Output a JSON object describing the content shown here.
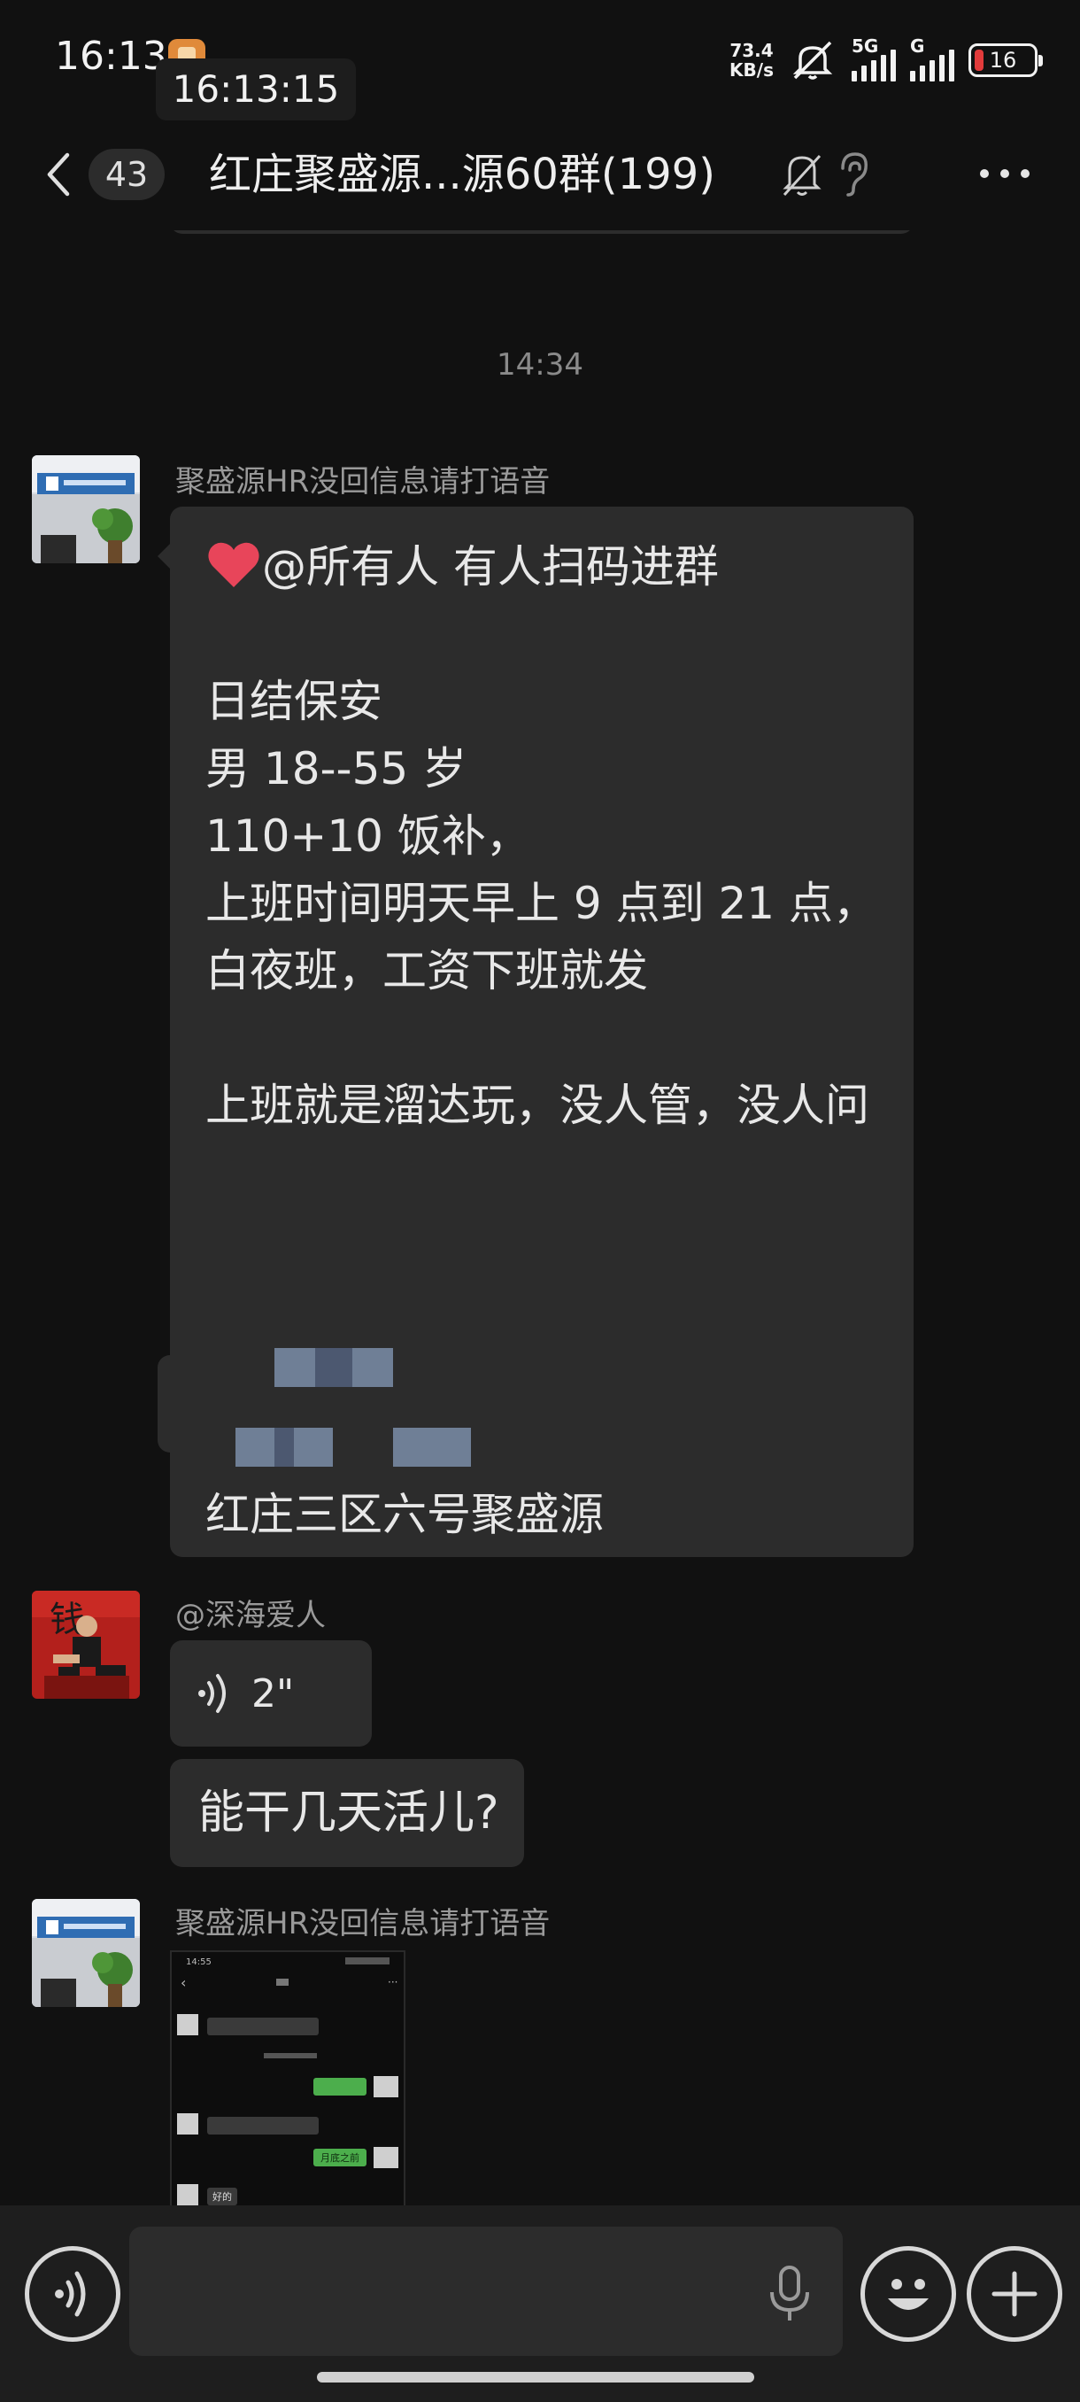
{
  "status_bar": {
    "time": "16:13",
    "clock_overlay": "16:13:15",
    "net_speed_value": "73.4",
    "net_speed_unit": "KB/s",
    "signal1_label": "5G",
    "signal2_label": "G",
    "battery_level": "16",
    "battery_color": "#e23b3b"
  },
  "header": {
    "unread_count": "43",
    "title": "红庄聚盛源...源60群(199)",
    "icons": [
      "back-icon",
      "mute-bell-icon",
      "ear-icon",
      "more-icon"
    ]
  },
  "chat": {
    "timestamp": "14:34",
    "messages": [
      {
        "sender": "聚盛源HR没回信息请打语音",
        "lines": [
          "@所有人  有人扫码进群",
          "",
          "日结保安",
          "男 18--55 岁",
          "110+10 饭补，",
          "上班时间明天早上 9 点到 21 点，",
          "白夜班，工资下班就发",
          "",
          "上班就是溜达玩，没人管，没人问"
        ],
        "footer": "红庄三区六号聚盛源"
      },
      {
        "sender": "@深海爱人",
        "voice_duration": "2\"",
        "text": "能干几天活儿?"
      },
      {
        "sender": "聚盛源HR没回信息请打语音",
        "image_time": "14:55",
        "image_bubble_text": "好的",
        "image_green_text": "月底之前"
      }
    ]
  },
  "input_bar": {
    "placeholder": "",
    "icons": [
      "voice-toggle-icon",
      "mic-icon",
      "emoji-icon",
      "plus-icon"
    ]
  },
  "colors": {
    "background": "#111111",
    "bubble": "#2c2c2c",
    "heart": "#e8455a"
  }
}
